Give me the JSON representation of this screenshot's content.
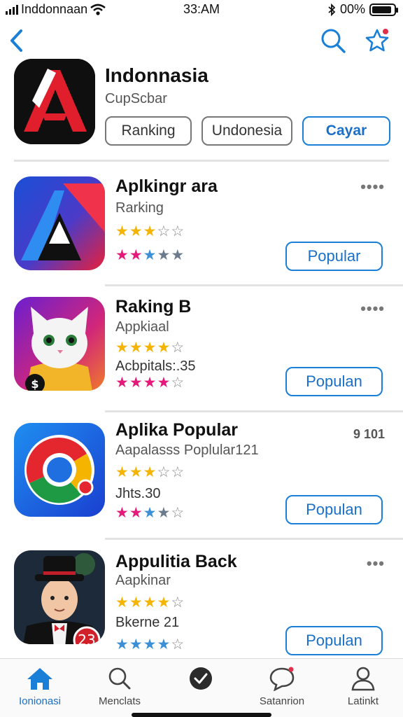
{
  "status_bar": {
    "carrier": "Inddonnaan",
    "time": "33:AM",
    "battery": "00%",
    "battery_level": 0.9,
    "icons": [
      "signal-icon",
      "wifi-icon",
      "bluetooth-icon",
      "battery-icon"
    ]
  },
  "nav": {
    "icons": [
      "chevron-left-icon",
      "search-icon",
      "star-notification-icon"
    ]
  },
  "header": {
    "title": "Indonnasia",
    "subtitle": "CupScbar",
    "chips": [
      "Ranking",
      "Undonesia",
      "Cayar"
    ]
  },
  "apps": [
    {
      "title": "Aplkingr ara",
      "subtitle": "Rarking",
      "extra": "",
      "rating_1": 3,
      "rating_2": 5,
      "more": "••••",
      "button": "Popular"
    },
    {
      "title": "Raking B",
      "subtitle": "Appkiaal",
      "extra": "Acbpitals:.35",
      "rating_1": 4,
      "rating_2": 4,
      "more": "••••",
      "button": "Populan"
    },
    {
      "title": "Aplika Popular",
      "subtitle": "Aapalasss Poplular121",
      "extra": "Jhts.30",
      "rating_1": 3,
      "rating_2": 4,
      "count": "9 101",
      "button": "Populan"
    },
    {
      "title": "Appulitia Back",
      "subtitle": "Aapkinar",
      "extra": "Bkerne 21",
      "rating_1": 4,
      "rating_2": 4,
      "more": "•••",
      "badge": "23",
      "button": "Populan"
    }
  ],
  "tab_bar": {
    "tabs": [
      {
        "label": "Ionionasi",
        "icon": "home-icon",
        "active": true
      },
      {
        "label": "Menclats",
        "icon": "search-icon",
        "active": false
      },
      {
        "label": "",
        "icon": "checkmark-circle-icon",
        "active": false
      },
      {
        "label": "Satanrion",
        "icon": "chat-bubble-icon",
        "active": false
      },
      {
        "label": "Latinkt",
        "icon": "person-icon",
        "active": false
      }
    ]
  },
  "colors": {
    "accent": "#1a7fd6",
    "star_gold": "#f5b400",
    "star_pink": "#e6197a",
    "star_blue": "#3a8fd6",
    "star_gray": "#6b7b8c"
  }
}
